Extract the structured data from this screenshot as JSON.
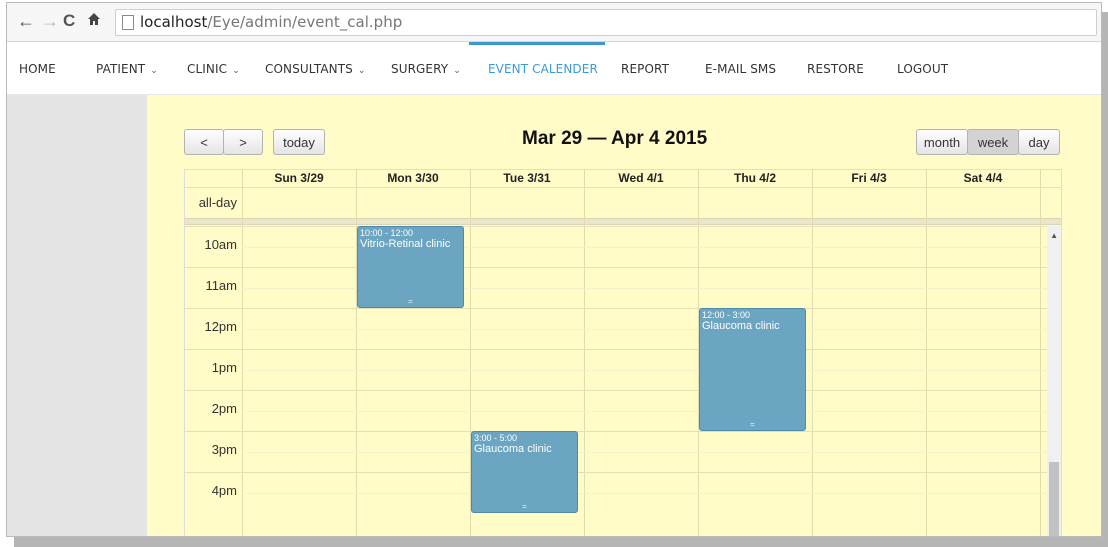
{
  "browser": {
    "nav": {
      "back": "←",
      "forward": "→",
      "reload": "C",
      "home": "🏠"
    },
    "url_host": "localhost",
    "url_path": "/Eye/admin/event_cal.php"
  },
  "sitenav": {
    "items": [
      {
        "label": "HOME",
        "dropdown": false
      },
      {
        "label": "PATIENT",
        "dropdown": true
      },
      {
        "label": "CLINIC",
        "dropdown": true
      },
      {
        "label": "CONSULTANTS",
        "dropdown": true
      },
      {
        "label": "SURGERY",
        "dropdown": true
      },
      {
        "label": "EVENT CALENDER",
        "dropdown": false,
        "active": true
      },
      {
        "label": "REPORT",
        "dropdown": false
      },
      {
        "label": "E-MAIL SMS",
        "dropdown": false
      },
      {
        "label": "RESTORE",
        "dropdown": false
      },
      {
        "label": "LOGOUT",
        "dropdown": false
      }
    ],
    "chevron": "⌄"
  },
  "toolbar": {
    "prev": "<",
    "next": ">",
    "today": "today",
    "title": "Mar 29 — Apr 4 2015",
    "views": [
      {
        "label": "month",
        "active": false
      },
      {
        "label": "week",
        "active": true
      },
      {
        "label": "day",
        "active": false
      }
    ]
  },
  "calendar": {
    "days": [
      "Sun 3/29",
      "Mon 3/30",
      "Tue 3/31",
      "Wed 4/1",
      "Thu 4/2",
      "Fri 4/3",
      "Sat 4/4"
    ],
    "allday_label": "all-day",
    "hours": [
      "10am",
      "11am",
      "12pm",
      "1pm",
      "2pm",
      "3pm",
      "4pm"
    ],
    "events": [
      {
        "day": 1,
        "time": "10:00 - 12:00",
        "title": "Vitrio-Retinal clinic",
        "start": 10,
        "end": 12
      },
      {
        "day": 4,
        "time": "12:00 - 3:00",
        "title": "Glaucoma clinic",
        "start": 12,
        "end": 15
      },
      {
        "day": 2,
        "time": "3:00 - 5:00",
        "title": "Glaucoma clinic",
        "start": 15,
        "end": 17
      }
    ],
    "event_color": "#6ba5c2",
    "background": "#fffcc7"
  }
}
